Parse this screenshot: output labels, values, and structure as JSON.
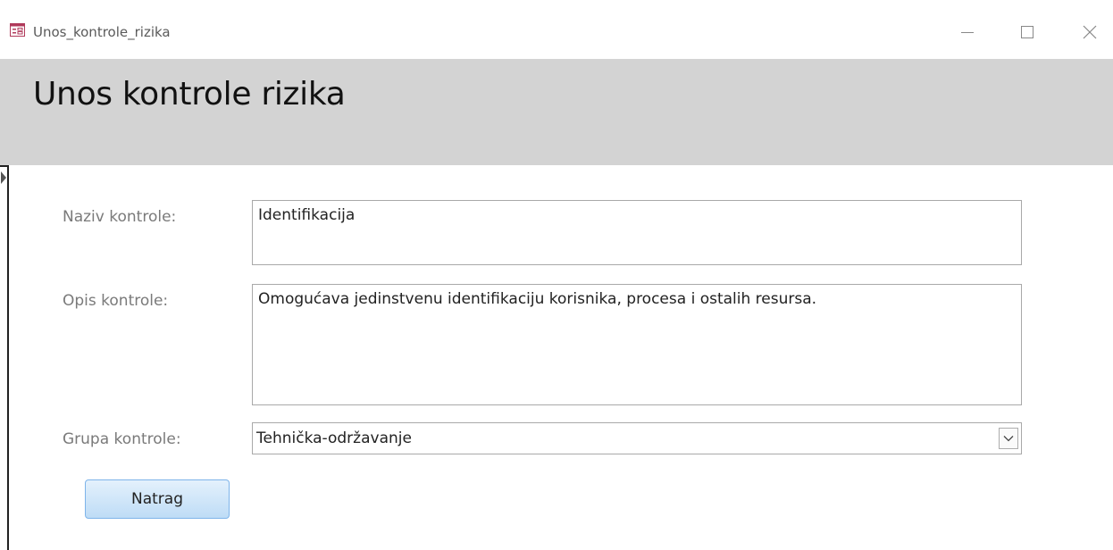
{
  "window": {
    "title": "Unos_kontrole_rizika",
    "icon": "form-icon",
    "controls": [
      "minimize-icon",
      "maximize-icon",
      "close-icon"
    ]
  },
  "header": {
    "title": "Unos kontrole rizika"
  },
  "form": {
    "naziv": {
      "label": "Naziv kontrole:",
      "value": "Identifikacija"
    },
    "opis": {
      "label": "Opis kontrole:",
      "value": "Omogućava jedinstvenu identifikaciju korisnika, procesa i ostalih resursa."
    },
    "grupa": {
      "label": "Grupa kontrole:",
      "value": "Tehnička-održavanje"
    }
  },
  "buttons": {
    "back_label": "Natrag"
  },
  "colors": {
    "header_bg": "#d3d3d3",
    "label_text": "#7a7a7a",
    "button_border": "#7eb4ea"
  }
}
